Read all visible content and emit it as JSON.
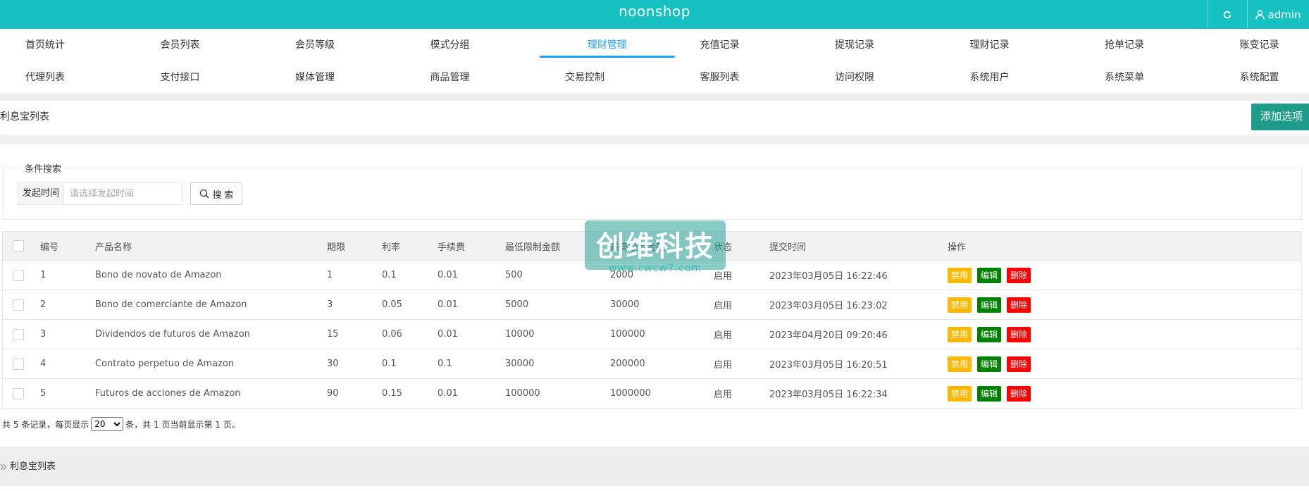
{
  "header": {
    "brand": "noonshop",
    "user": "admin",
    "refresh_icon": "refresh-icon",
    "user_icon": "user-icon"
  },
  "nav": {
    "row1": [
      "首页统计",
      "会员列表",
      "会员等级",
      "模式分组",
      "理财管理",
      "充值记录",
      "提现记录",
      "理财记录",
      "抢单记录",
      "账变记录"
    ],
    "row2": [
      "代理列表",
      "支付接口",
      "媒体管理",
      "商品管理",
      "交易控制",
      "客服列表",
      "访问权限",
      "系统用户",
      "系统菜单",
      "系统配置"
    ],
    "active": "理财管理"
  },
  "page": {
    "title": "利息宝列表",
    "add_button": "添加选项"
  },
  "search": {
    "legend": "条件搜索",
    "time_label": "发起时间",
    "time_placeholder": "请选择发起时间",
    "search_button": "搜 索"
  },
  "table": {
    "headers": [
      "编号",
      "产品名称",
      "期限",
      "利率",
      "手续费",
      "最低限制金额",
      "最高限制金额",
      "状态",
      "提交时间",
      "操作"
    ],
    "rows": [
      {
        "id": "1",
        "name": "Bono de novato de Amazon",
        "term": "1",
        "rate": "0.1",
        "fee": "0.01",
        "min": "500",
        "max": "2000",
        "status": "启用",
        "time": "2023年03月05日 16:22:46"
      },
      {
        "id": "2",
        "name": "Bono de comerciante de Amazon",
        "term": "3",
        "rate": "0.05",
        "fee": "0.01",
        "min": "5000",
        "max": "30000",
        "status": "启用",
        "time": "2023年03月05日 16:23:02"
      },
      {
        "id": "3",
        "name": "Dividendos de futuros de Amazon",
        "term": "15",
        "rate": "0.06",
        "fee": "0.01",
        "min": "10000",
        "max": "100000",
        "status": "启用",
        "time": "2023年04月20日 09:20:46"
      },
      {
        "id": "4",
        "name": "Contrato perpetuo de Amazon",
        "term": "30",
        "rate": "0.1",
        "fee": "0.1",
        "min": "30000",
        "max": "200000",
        "status": "启用",
        "time": "2023年03月05日 16:20:51"
      },
      {
        "id": "5",
        "name": "Futuros de acciones de Amazon",
        "term": "90",
        "rate": "0.15",
        "fee": "0.01",
        "min": "100000",
        "max": "1000000",
        "status": "启用",
        "time": "2023年03月05日 16:22:34"
      }
    ],
    "ops": {
      "disable": "禁用",
      "edit": "编辑",
      "delete": "删除"
    },
    "op_colors": {
      "disable": "#ffb800",
      "edit": "#008000",
      "delete": "#ff0000"
    }
  },
  "pager": {
    "prefix": "共 5 条记录，每页显示",
    "page_size": "20",
    "suffix": "条，共 1 页当前显示第 1 页。"
  },
  "footer": {
    "crumb": "利息宝列表"
  },
  "watermark": {
    "big": "创维科技",
    "small": "www.cwcw7.com"
  },
  "colors": {
    "topbar": "#16c1c2",
    "active_tab": "#1e9fff",
    "add_button": "#1e9c8a"
  }
}
